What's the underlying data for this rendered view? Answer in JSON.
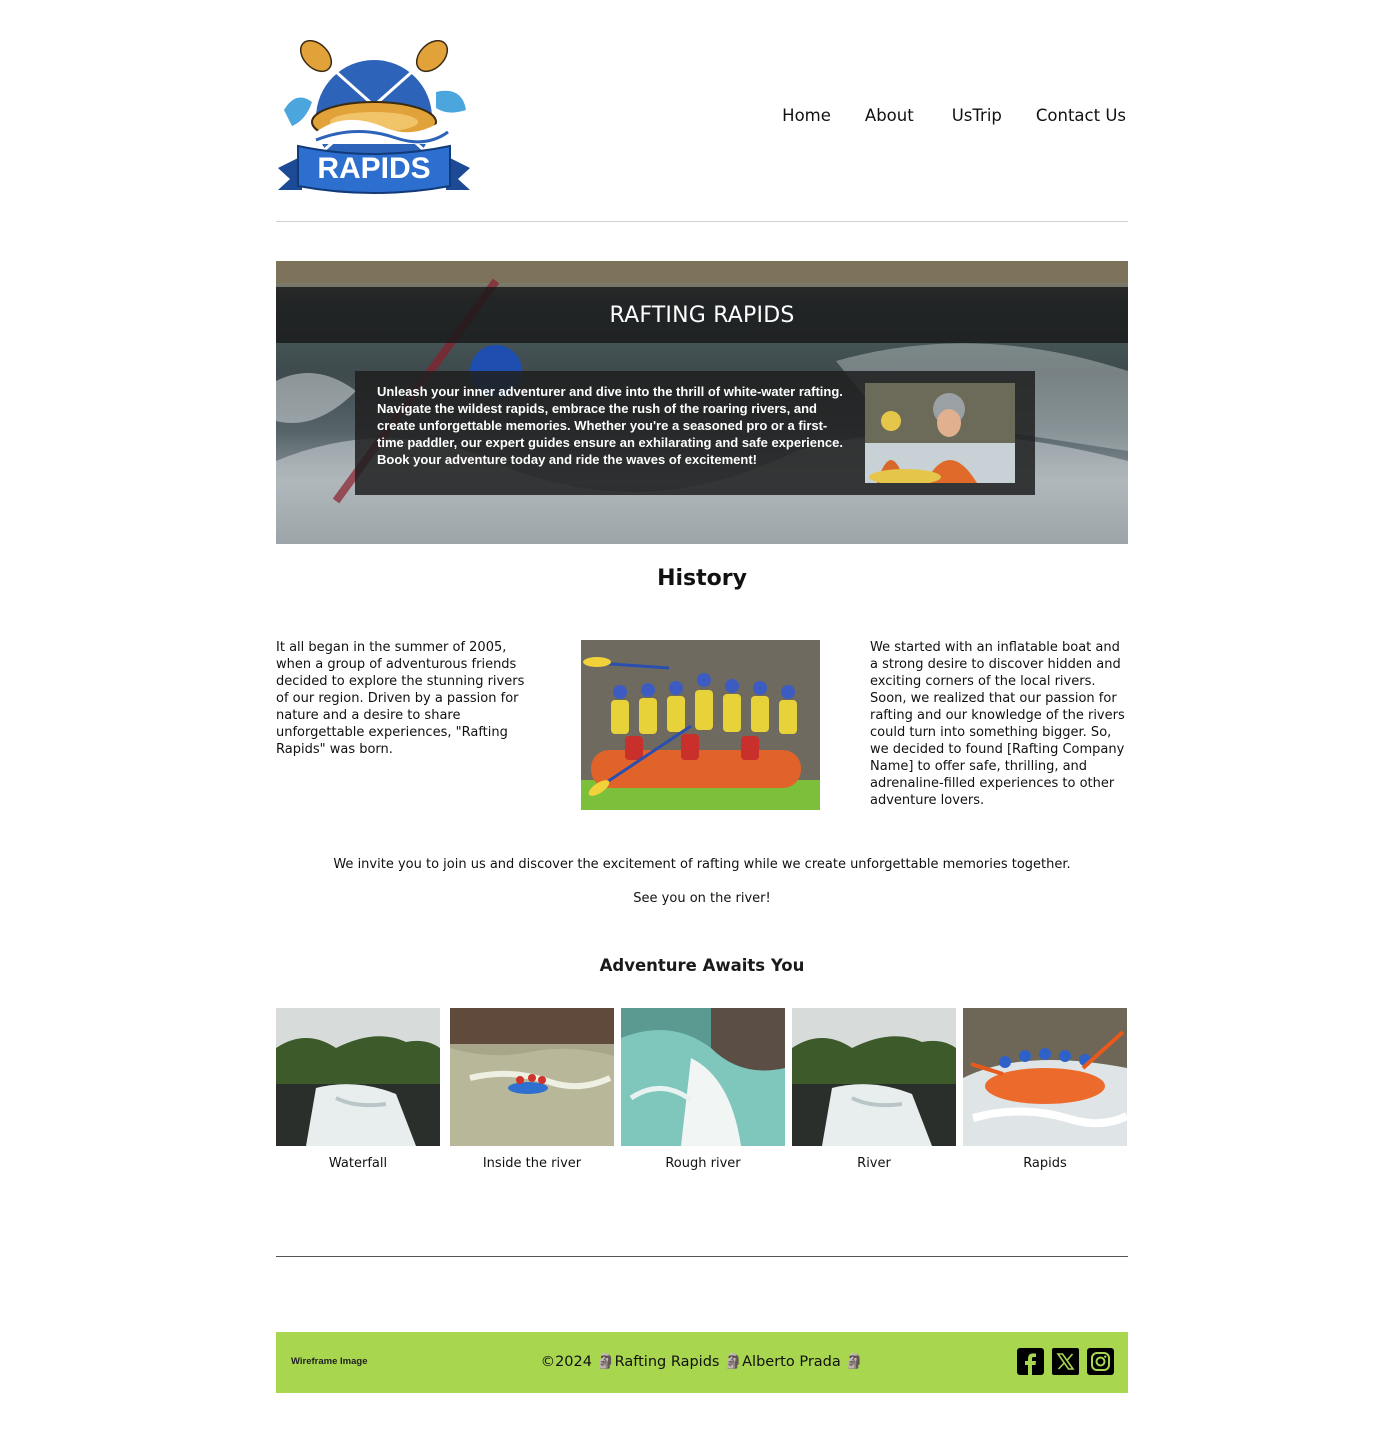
{
  "header": {
    "logo_text": "RAPIDS",
    "nav": [
      {
        "label": "Home"
      },
      {
        "label": "About"
      },
      {
        "label": "UsTrip"
      },
      {
        "label": "Contact Us"
      }
    ]
  },
  "hero": {
    "title": "RAFTING RAPIDS",
    "text": "Unleash your inner adventurer and dive into the thrill of white-water rafting. Navigate the wildest rapids, embrace the rush of the roaring rivers, and create unforgettable memories. Whether you're a seasoned pro or a first-time paddler, our expert guides ensure an exhilarating and safe experience. Book your adventure today and ride the waves of excitement!"
  },
  "history": {
    "title": "History",
    "left_text": "It all began in the summer of 2005, when a group of adventurous friends decided to explore the stunning rivers of our region. Driven by a passion for nature and a desire to share unforgettable experiences, \"Rafting Rapids\" was born.",
    "right_text": "We started with an inflatable boat and a strong desire to discover hidden and exciting corners of the local rivers. Soon, we realized that our passion for rafting and our knowledge of the rivers could turn into something bigger. So, we decided to found [Rafting Company Name] to offer safe, thrilling, and adrenaline-filled experiences to other adventure lovers.",
    "invite": "We invite you to join us and discover the excitement of rafting while we create unforgettable memories together.",
    "see_you": "See you on the river!"
  },
  "gallery": {
    "title": "Adventure Awaits You",
    "items": [
      {
        "caption": "Waterfall"
      },
      {
        "caption": "Inside the river"
      },
      {
        "caption": "Rough river"
      },
      {
        "caption": "River"
      },
      {
        "caption": "Rapids"
      }
    ]
  },
  "footer": {
    "wireframe_label": "Wireframe Image",
    "copyright": "©2024 🗿Rafting Rapids 🗿Alberto Prada 🗿",
    "bg_color": "#a8d64f",
    "social_icons": [
      "facebook-icon",
      "x-icon",
      "instagram-icon"
    ]
  }
}
